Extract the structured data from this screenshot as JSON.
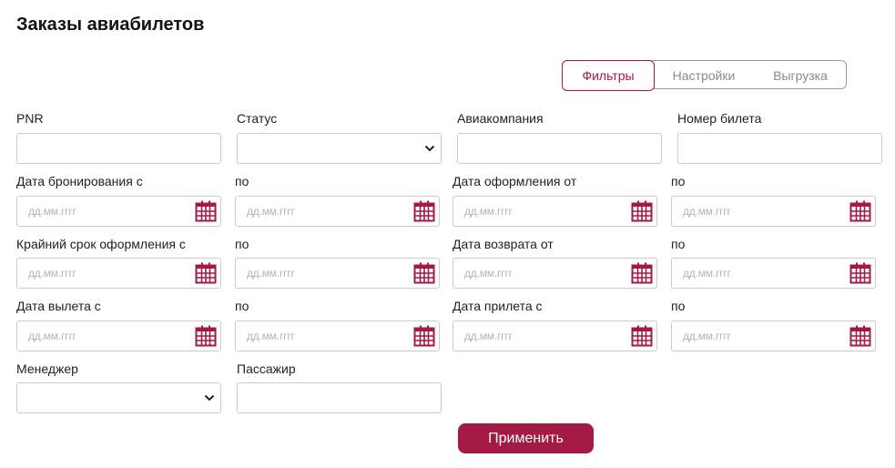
{
  "page": {
    "title": "Заказы авиабилетов"
  },
  "tabs": [
    {
      "label": "Фильтры",
      "active": true
    },
    {
      "label": "Настройки",
      "active": false
    },
    {
      "label": "Выгрузка",
      "active": false
    }
  ],
  "fields": {
    "pnr": {
      "label": "PNR",
      "value": ""
    },
    "status": {
      "label": "Статус",
      "value": ""
    },
    "airline": {
      "label": "Авиакомпания",
      "value": ""
    },
    "ticket_number": {
      "label": "Номер билета",
      "value": ""
    },
    "booking_date_from": {
      "label": "Дата бронирования с",
      "placeholder": "дд.мм.гггг"
    },
    "booking_date_to": {
      "label": "по",
      "placeholder": "дд.мм.гггг"
    },
    "issue_date_from": {
      "label": "Дата оформления от",
      "placeholder": "дд.мм.гггг"
    },
    "issue_date_to": {
      "label": "по",
      "placeholder": "дд.мм.гггг"
    },
    "deadline_from": {
      "label": "Крайний срок оформления с",
      "placeholder": "дд.мм.гггг"
    },
    "deadline_to": {
      "label": "по",
      "placeholder": "дд.мм.гггг"
    },
    "return_date_from": {
      "label": "Дата возврата от",
      "placeholder": "дд.мм.гггг"
    },
    "return_date_to": {
      "label": "по",
      "placeholder": "дд.мм.гггг"
    },
    "departure_from": {
      "label": "Дата вылета с",
      "placeholder": "дд.мм.гггг"
    },
    "departure_to": {
      "label": "по",
      "placeholder": "дд.мм.гггг"
    },
    "arrival_from": {
      "label": "Дата прилета с",
      "placeholder": "дд.мм.гггг"
    },
    "arrival_to": {
      "label": "по",
      "placeholder": "дд.мм.гггг"
    },
    "manager": {
      "label": "Менеджер",
      "value": ""
    },
    "passenger": {
      "label": "Пассажир",
      "value": ""
    }
  },
  "actions": {
    "apply_label": "Применить"
  },
  "icons": {
    "calendar": "calendar-icon",
    "dropdown": "chevron-down-icon"
  },
  "colors": {
    "accent": "#a31a45",
    "border": "#cccccc",
    "placeholder": "#b4b4b4"
  }
}
